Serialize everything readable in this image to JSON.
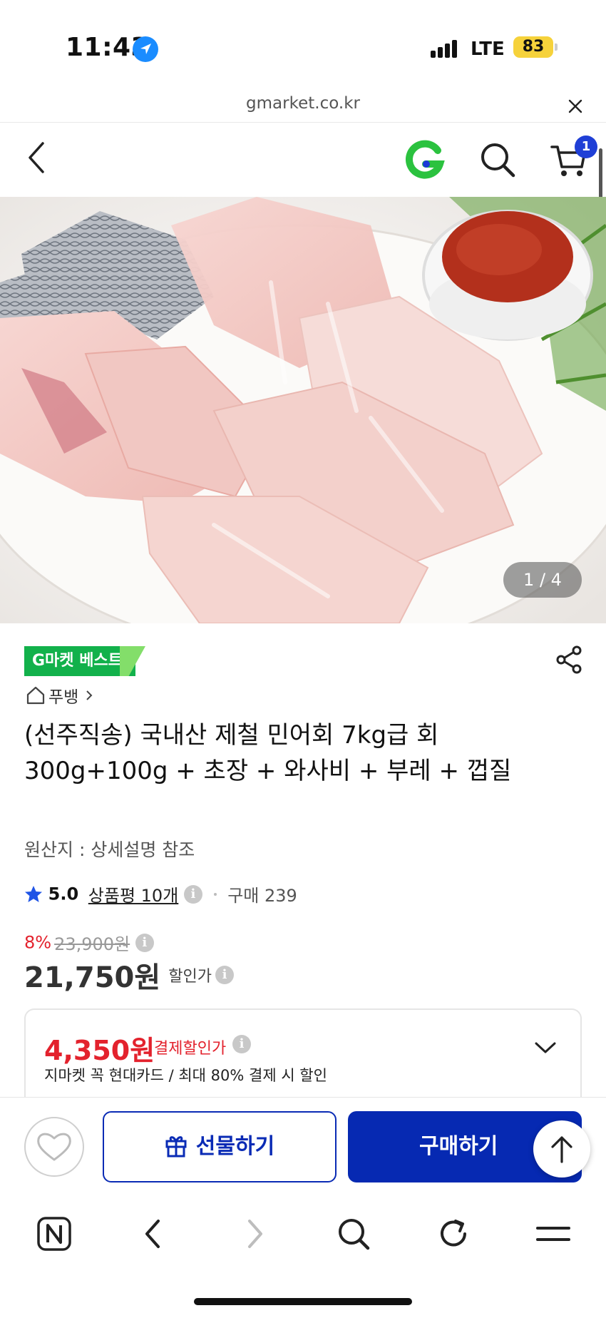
{
  "status_bar": {
    "time": "11:43",
    "network": "LTE",
    "battery": "83"
  },
  "browser": {
    "url": "gmarket.co.kr"
  },
  "header": {
    "cart_count": "1"
  },
  "gallery": {
    "counter": "1 / 4"
  },
  "product": {
    "badge": "G마켓 베스트",
    "brand": "푸뱅",
    "title": "(선주직송) 국내산 제철 민어회 7kg급 회 300g+100g + 초장 + 와사비 + 부레 + 껍질",
    "origin": "원산지 : 상세설명 참조",
    "rating": {
      "score": "5.0",
      "reviews": "상품평 10개",
      "purchases": "구매 239"
    },
    "pricing": {
      "discount_rate": "8%",
      "original_price": "23,900원",
      "sale_price": "21,750원",
      "sale_label": "할인가"
    },
    "card_discount": {
      "price": "4,350원",
      "label": "결제할인가",
      "description": "지마켓 꼭 현대카드 / 최대 80% 결제 시 할인"
    }
  },
  "actions": {
    "gift_label": "선물하기",
    "buy_label": "구매하기"
  },
  "colors": {
    "brand_green": "#12b14b",
    "buy_blue": "#0629b2",
    "discount_red": "#e3222d"
  }
}
